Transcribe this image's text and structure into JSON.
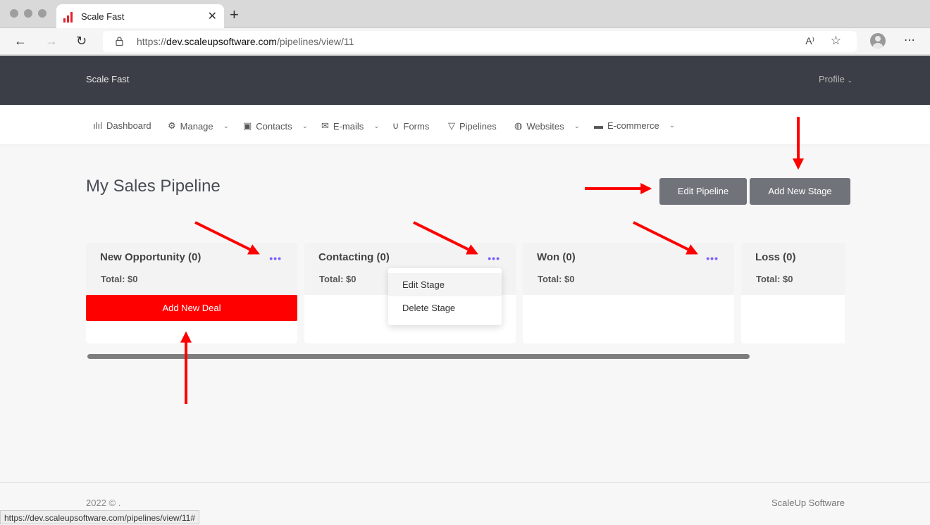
{
  "browser": {
    "tab_title": "Scale Fast",
    "url_prefix": "https://",
    "url_host": "dev.scaleupsoftware.com",
    "url_path": "/pipelines/view/11",
    "status_url": "https://dev.scaleupsoftware.com/pipelines/view/11#"
  },
  "header": {
    "brand": "Scale Fast",
    "profile": "Profile"
  },
  "menu": [
    {
      "label": "Dashboard",
      "icon": "bar-chart-icon",
      "dropdown": false
    },
    {
      "label": "Manage",
      "icon": "gear-icon",
      "dropdown": true
    },
    {
      "label": "Contacts",
      "icon": "contact-card-icon",
      "dropdown": true
    },
    {
      "label": "E-mails",
      "icon": "mail-icon",
      "dropdown": true
    },
    {
      "label": "Forms",
      "icon": "magnet-icon",
      "dropdown": false
    },
    {
      "label": "Pipelines",
      "icon": "funnel-icon",
      "dropdown": false
    },
    {
      "label": "Websites",
      "icon": "globe-icon",
      "dropdown": true
    },
    {
      "label": "E-commerce",
      "icon": "envelope-icon",
      "dropdown": true
    }
  ],
  "page": {
    "title": "My Sales Pipeline",
    "edit_pipeline": "Edit Pipeline",
    "add_new_stage": "Add New Stage"
  },
  "stages": [
    {
      "name": "New Opportunity (0)",
      "total": "Total: $0",
      "has_menu": true
    },
    {
      "name": "Contacting (0)",
      "total": "Total: $0",
      "has_menu": true
    },
    {
      "name": "Won (0)",
      "total": "Total: $0",
      "has_menu": true
    },
    {
      "name": "Loss (0)",
      "total": "Total: $0",
      "has_menu": false
    }
  ],
  "add_new_deal": "Add New Deal",
  "stage_menu": {
    "edit": "Edit Stage",
    "delete": "Delete Stage"
  },
  "footer": {
    "copyright": "2022 © .",
    "company": "ScaleUp Software"
  },
  "colors": {
    "header_bg": "#3b3e46",
    "accent_red": "#ff0000",
    "dots_purple": "#7c5cff",
    "button_gray": "#707379"
  }
}
